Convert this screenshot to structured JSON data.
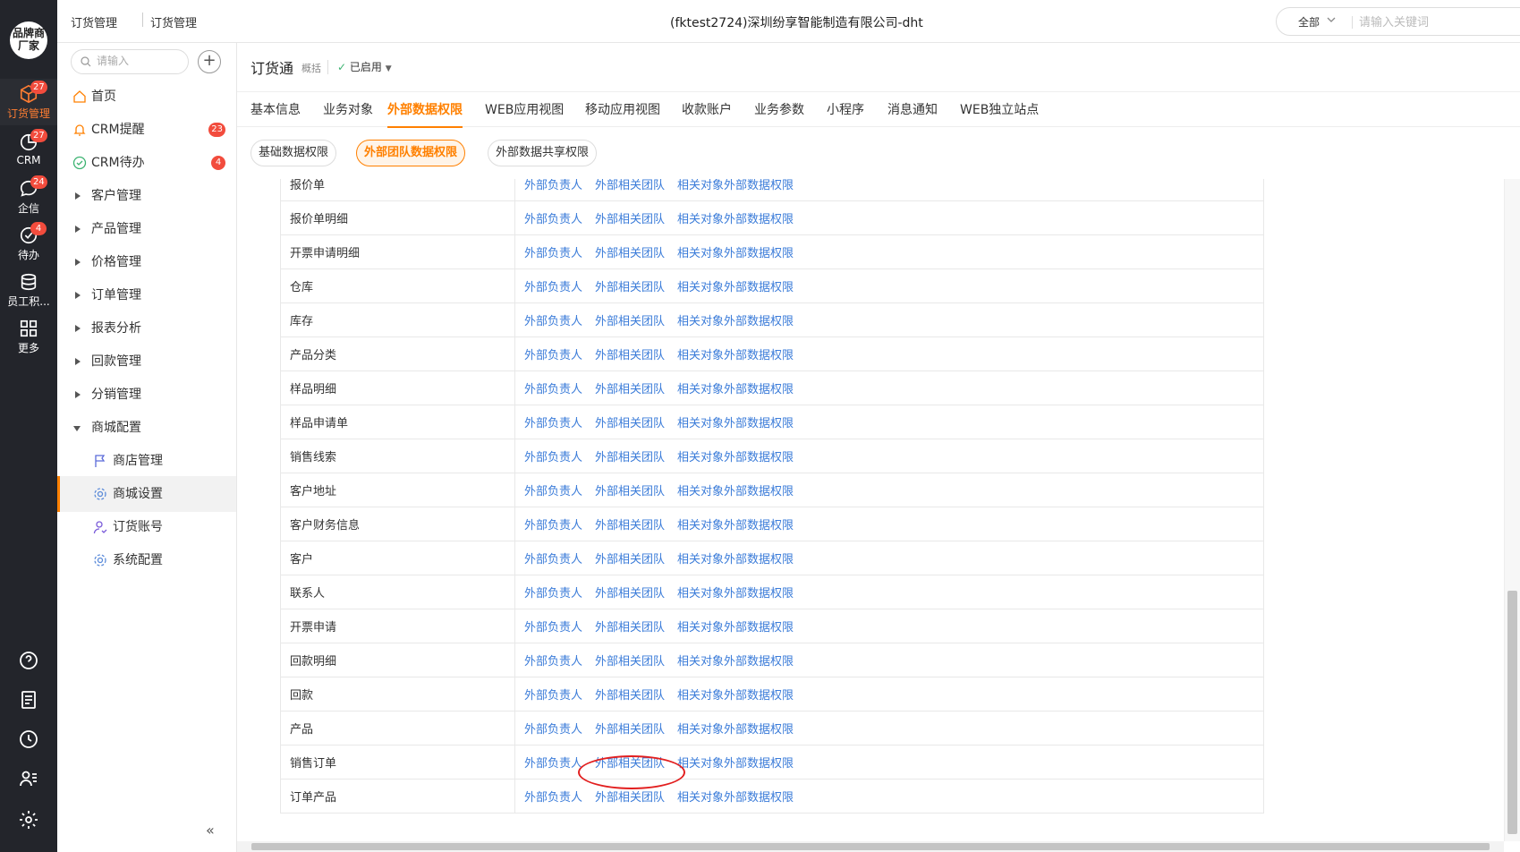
{
  "rail": {
    "logo_line1": "品牌商",
    "logo_line2": "厂家",
    "items": [
      {
        "label": "订货管理",
        "badge": "27",
        "icon": "box-icon",
        "active": true
      },
      {
        "label": "CRM",
        "badge": "27",
        "icon": "crm-icon"
      },
      {
        "label": "企信",
        "badge": "24",
        "icon": "chat-icon"
      },
      {
        "label": "待办",
        "badge": "4",
        "icon": "todo-check-icon"
      },
      {
        "label": "员工积...",
        "badge": "",
        "icon": "database-icon"
      },
      {
        "label": "更多",
        "badge": "",
        "icon": "grid-icon"
      }
    ],
    "bottom_icons": [
      "help-icon",
      "notes-icon",
      "clock-icon",
      "contacts-icon",
      "settings-icon"
    ]
  },
  "topbar": {
    "crumb1": "订货管理",
    "crumb2": "订货管理",
    "title": "(fktest2724)深圳纷享智能制造有限公司-dht",
    "search_scope": "全部",
    "search_placeholder": "请输入关键词"
  },
  "sidebar": {
    "search_placeholder": "请输入",
    "items": [
      {
        "label": "首页",
        "icon": "home-icon"
      },
      {
        "label": "CRM提醒",
        "icon": "bell-icon",
        "badge": "23"
      },
      {
        "label": "CRM待办",
        "icon": "check-circle-icon",
        "badge": "4"
      },
      {
        "label": "客户管理"
      },
      {
        "label": "产品管理"
      },
      {
        "label": "价格管理"
      },
      {
        "label": "订单管理"
      },
      {
        "label": "报表分析"
      },
      {
        "label": "回款管理"
      },
      {
        "label": "分销管理"
      },
      {
        "label": "商城配置",
        "expanded": true
      },
      {
        "label": "商店管理",
        "icon": "flag-icon",
        "sub": true
      },
      {
        "label": "商城设置",
        "icon": "gear-icon",
        "sub": true,
        "active": true
      },
      {
        "label": "订货账号",
        "icon": "user-account-icon",
        "sub": true
      },
      {
        "label": "系统配置",
        "icon": "gear-icon",
        "sub": true
      }
    ],
    "collapse_label": "«"
  },
  "page": {
    "title": "订货通",
    "subtitle": "概括",
    "status": "已启用",
    "tabs": [
      "基本信息",
      "业务对象",
      "外部数据权限",
      "WEB应用视图",
      "移动应用视图",
      "收款账户",
      "业务参数",
      "小程序",
      "消息通知",
      "WEB独立站点"
    ],
    "active_tab": "外部数据权限",
    "subtabs": [
      "基础数据权限",
      "外部团队数据权限",
      "外部数据共享权限"
    ],
    "active_subtab": "外部团队数据权限"
  },
  "table": {
    "link_labels": [
      "外部负责人",
      "外部相关团队",
      "相关对象外部数据权限"
    ],
    "rows": [
      "报价单",
      "报价单明细",
      "开票申请明细",
      "仓库",
      "库存",
      "产品分类",
      "样品明细",
      "样品申请单",
      "销售线索",
      "客户地址",
      "客户财务信息",
      "客户",
      "联系人",
      "开票申请",
      "回款明细",
      "回款",
      "产品",
      "销售订单",
      "订单产品"
    ]
  },
  "colors": {
    "accent": "#ff8000",
    "link": "#3b7cd9",
    "badge": "#f24c3d",
    "rail": "#23252b",
    "annotation": "#e21f1f"
  }
}
